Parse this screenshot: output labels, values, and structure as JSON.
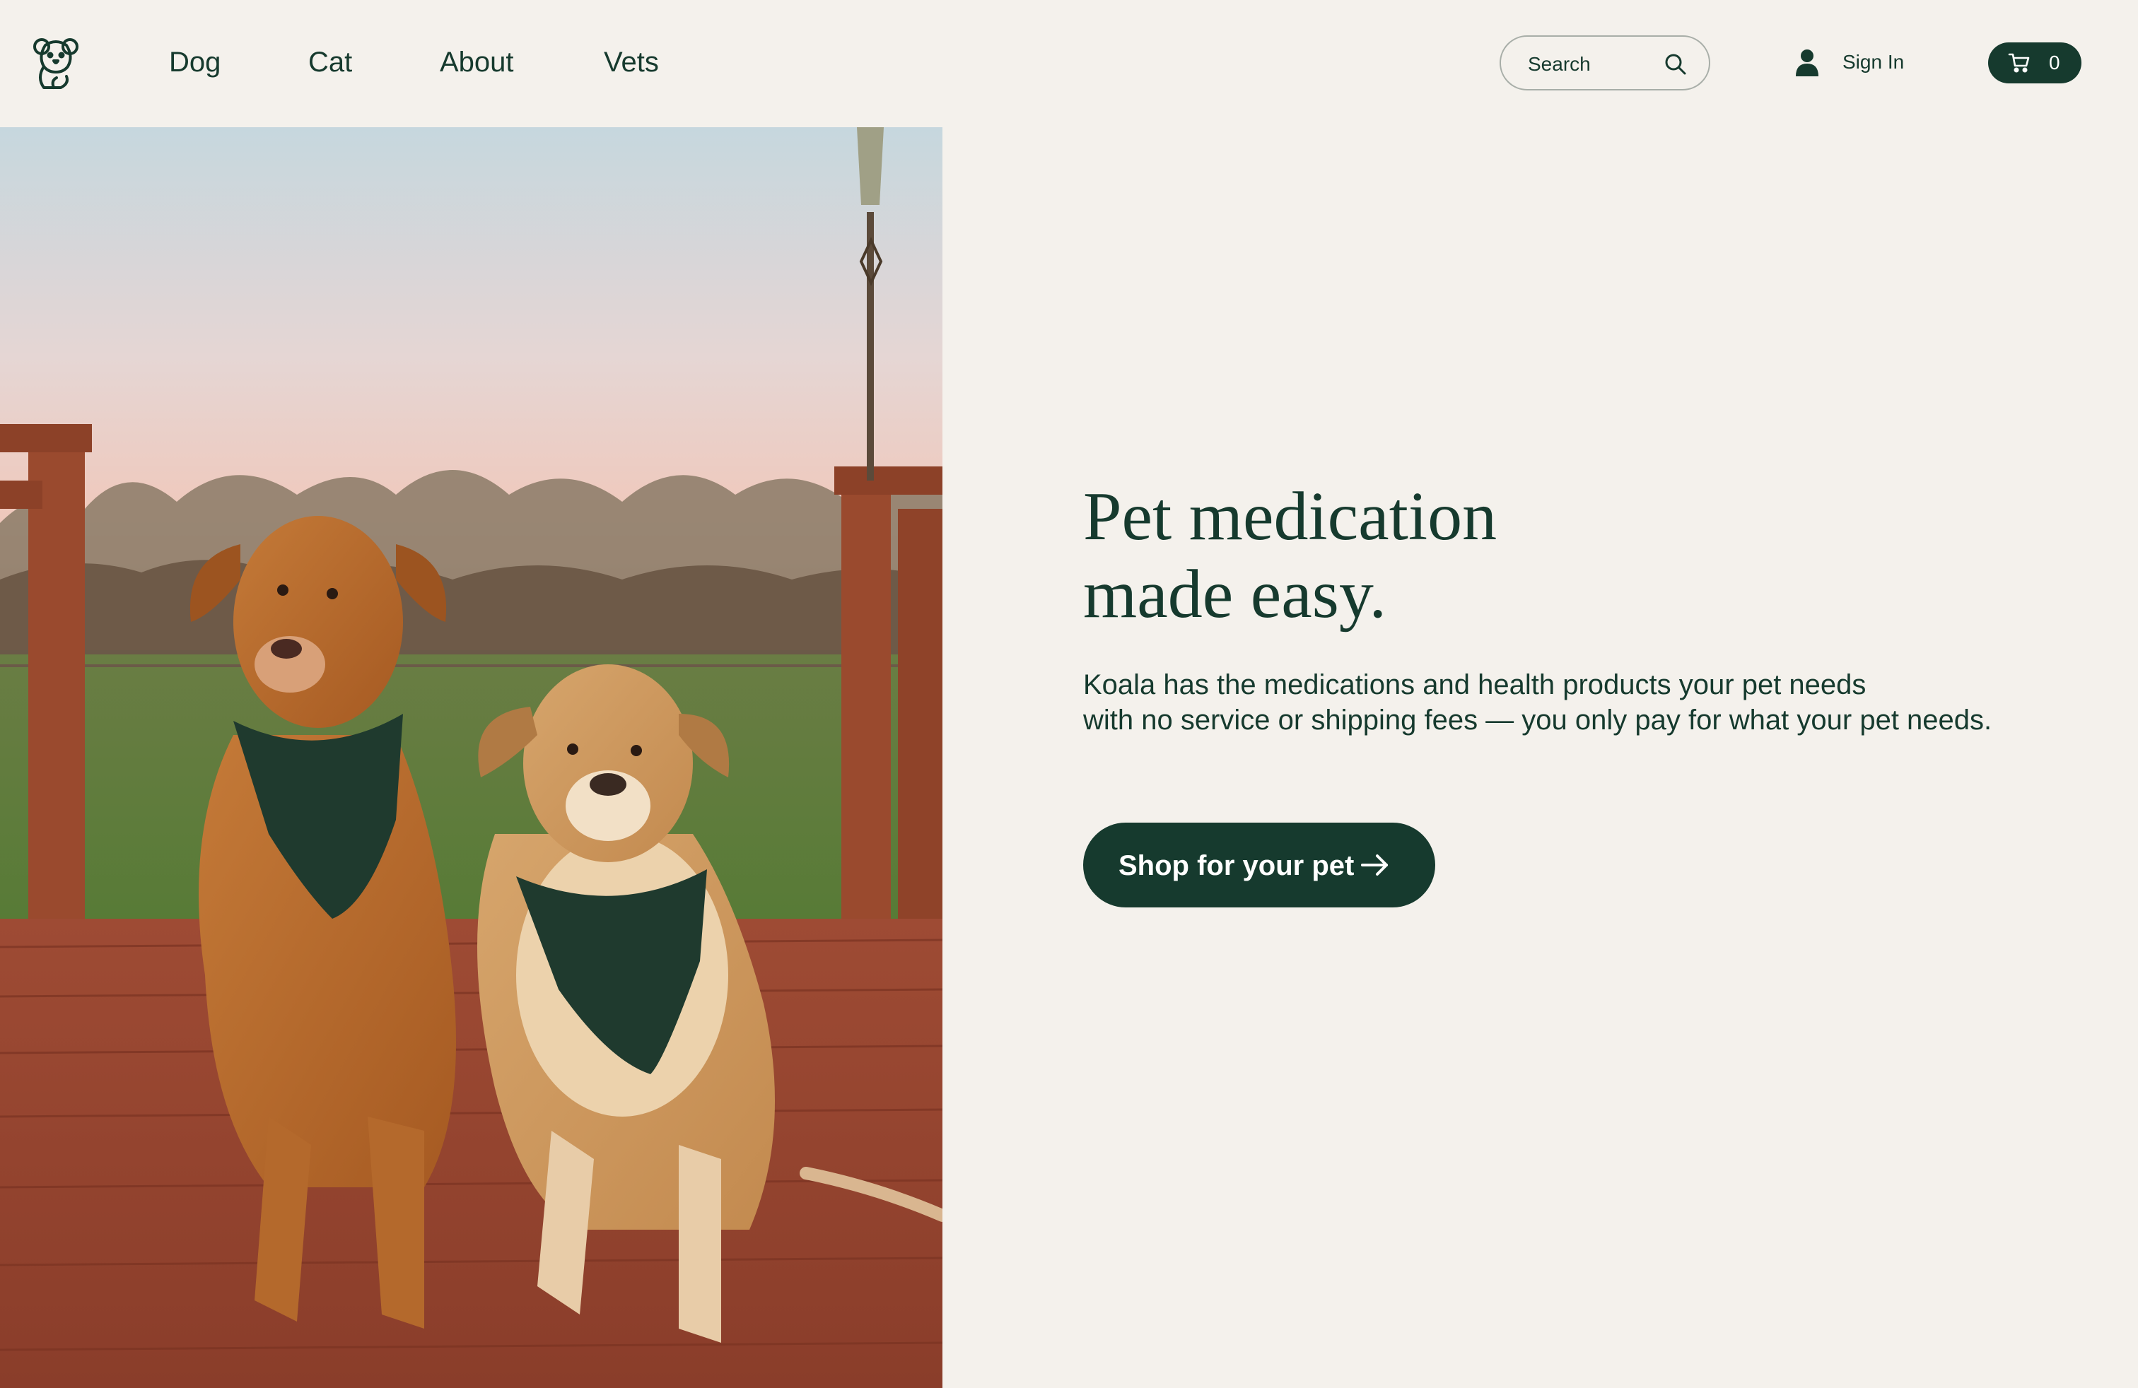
{
  "brand": {
    "logo_icon": "koala-logo-icon",
    "color": "#163a2e"
  },
  "nav": {
    "items": [
      {
        "label": "Dog"
      },
      {
        "label": "Cat"
      },
      {
        "label": "About"
      },
      {
        "label": "Vets"
      }
    ]
  },
  "search": {
    "placeholder": "Search",
    "icon": "search-icon"
  },
  "account": {
    "label": "Sign In",
    "icon": "user-icon"
  },
  "cart": {
    "count": "0",
    "icon": "cart-icon"
  },
  "hero": {
    "image_icon": "two-dogs-photo",
    "headline_line1": "Pet medication",
    "headline_line2": "made easy.",
    "subtitle_line1": "Koala has the medications and health products your pet needs",
    "subtitle_line2": "with no service or shipping fees — you only pay for what your pet needs.",
    "cta_label": "Shop for your pet",
    "cta_icon": "arrow-right-icon"
  },
  "colors": {
    "background": "#f4f1ec",
    "primary": "#163a2e",
    "on_primary": "#ffffff"
  }
}
